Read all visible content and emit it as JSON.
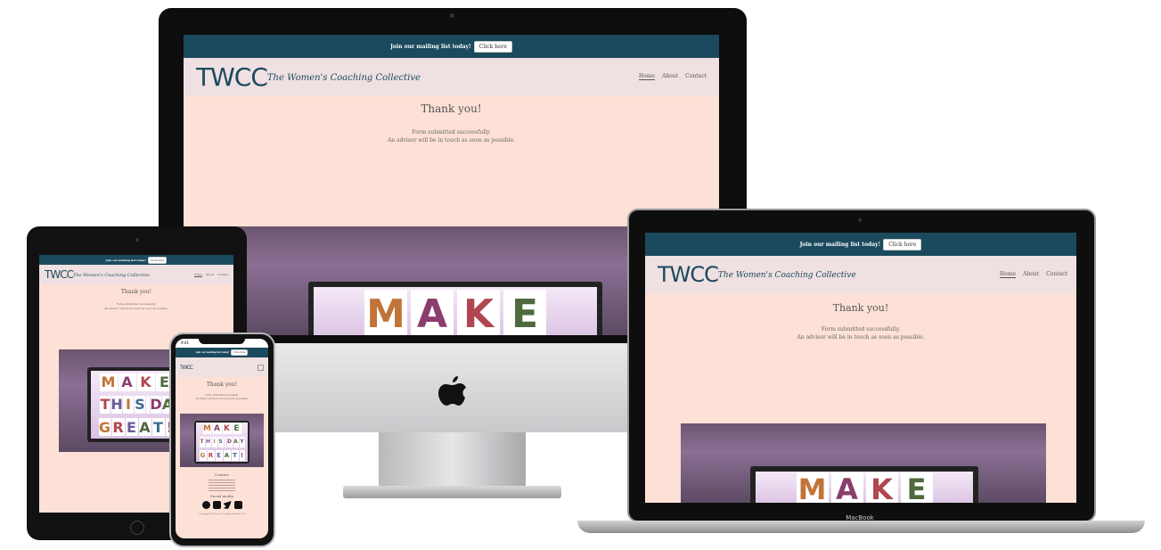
{
  "banner": {
    "text": "Join our mailing list today!",
    "button": "Click here"
  },
  "nav": {
    "logo": "TWCC",
    "tagline": "The Women's Coaching Collective",
    "links": [
      "Home",
      "About",
      "Contact"
    ]
  },
  "main": {
    "heading": "Thank you!",
    "line1": "Form submitted successfully.",
    "line2": "An advisor will be in touch as soon as possible."
  },
  "sign": {
    "row1": [
      "M",
      "A",
      "K",
      "E"
    ],
    "row2": [
      "T",
      "H",
      "I",
      "S",
      " ",
      "D",
      "A",
      "Y"
    ],
    "row3": [
      "G",
      "R",
      "E",
      "A",
      "T",
      "!"
    ]
  },
  "phone": {
    "time": "9:41",
    "footer_heading": "Contact",
    "social_heading": "Social media",
    "copyright": "© Copyright The Women's Coaching Collective 2021"
  },
  "laptop": {
    "brand": "MacBook"
  },
  "colors": {
    "banner": "#1b4a5e",
    "nav": "#efe0e1",
    "page": "#fde1d6"
  }
}
